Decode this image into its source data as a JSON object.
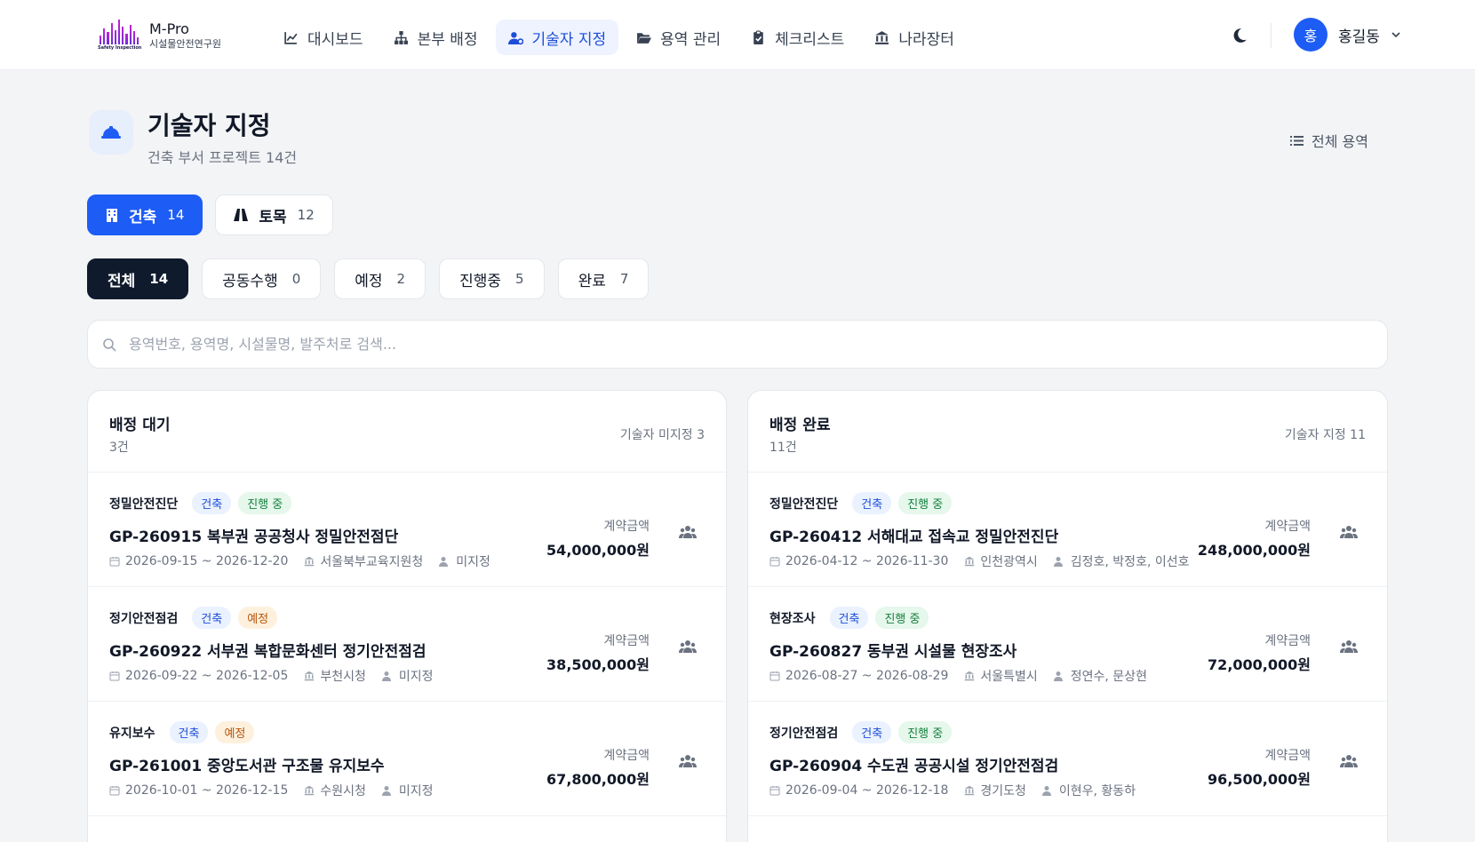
{
  "logo": {
    "title": "M-Pro",
    "subtitle": "시설물안전연구원",
    "tagline": "Safety Inspection"
  },
  "nav": [
    {
      "label": "대시보드",
      "icon": "chart-line-icon"
    },
    {
      "label": "본부 배정",
      "icon": "sitemap-icon"
    },
    {
      "label": "기술자 지정",
      "icon": "user-gear-icon",
      "active": true
    },
    {
      "label": "용역 관리",
      "icon": "folder-open-icon"
    },
    {
      "label": "체크리스트",
      "icon": "clipboard-check-icon"
    },
    {
      "label": "나라장터",
      "icon": "landmark-icon"
    }
  ],
  "user": {
    "initial": "홍",
    "name": "홍길동"
  },
  "page": {
    "title": "기술자 지정",
    "subtitle": "건축 부서 프로젝트 14건",
    "all_link": "전체 용역",
    "icon": "hard-hat-icon"
  },
  "dept_tabs": [
    {
      "label": "건축",
      "count": "14",
      "active": true,
      "icon": "building-icon"
    },
    {
      "label": "토목",
      "count": "12",
      "active": false,
      "icon": "road-icon"
    }
  ],
  "status_tabs": [
    {
      "label": "전체",
      "count": "14",
      "active": true
    },
    {
      "label": "공동수행",
      "count": "0"
    },
    {
      "label": "예정",
      "count": "2"
    },
    {
      "label": "진행중",
      "count": "5"
    },
    {
      "label": "완료",
      "count": "7"
    }
  ],
  "search": {
    "placeholder": "용역번호, 용역명, 시설물명, 발주처로 검색..."
  },
  "pending": {
    "title": "배정 대기",
    "count": "3건",
    "meta": "기술자 미지정 3",
    "items": [
      {
        "type": "정밀안전진단",
        "dept": "건축",
        "status": "진행 중",
        "status_color": "green",
        "title": "GP-260915  복부권 공공청사 정밀안전점단",
        "dates": "2026-09-15 ~ 2026-12-20",
        "client": "서울북부교육지원청",
        "engineers": "미지정",
        "amount_label": "계약금액",
        "amount": "54,000,000원"
      },
      {
        "type": "정기안전점검",
        "dept": "건축",
        "status": "예정",
        "status_color": "amber",
        "title": "GP-260922  서부권 복합문화센터 정기안전점검",
        "dates": "2026-09-22 ~ 2026-12-05",
        "client": "부천시청",
        "engineers": "미지정",
        "amount_label": "계약금액",
        "amount": "38,500,000원"
      },
      {
        "type": "유지보수",
        "dept": "건축",
        "status": "예정",
        "status_color": "amber",
        "title": "GP-261001  중앙도서관 구조물 유지보수",
        "dates": "2026-10-01 ~ 2026-12-15",
        "client": "수원시청",
        "engineers": "미지정",
        "amount_label": "계약금액",
        "amount": "67,800,000원"
      }
    ]
  },
  "assigned": {
    "title": "배정 완료",
    "count": "11건",
    "meta": "기술자 지정 11",
    "items": [
      {
        "type": "정밀안전진단",
        "dept": "건축",
        "status": "진행 중",
        "status_color": "green",
        "title": "GP-260412  서해대교 접속교 정밀안전진단",
        "dates": "2026-04-12 ~ 2026-11-30",
        "client": "인천광역시",
        "engineers": "김정호, 박정호, 이선호",
        "amount_label": "계약금액",
        "amount": "248,000,000원"
      },
      {
        "type": "현장조사",
        "dept": "건축",
        "status": "진행 중",
        "status_color": "green",
        "title": "GP-260827  동부권 시설물 현장조사",
        "dates": "2026-08-27 ~ 2026-08-29",
        "client": "서울특별시",
        "engineers": "정연수, 문상현",
        "amount_label": "계약금액",
        "amount": "72,000,000원"
      },
      {
        "type": "정기안전점검",
        "dept": "건축",
        "status": "진행 중",
        "status_color": "green",
        "title": "GP-260904  수도권 공공시설 정기안전점검",
        "dates": "2026-09-04 ~ 2026-12-18",
        "client": "경기도청",
        "engineers": "이현우, 황동하",
        "amount_label": "계약금액",
        "amount": "96,500,000원"
      }
    ]
  },
  "colors": {
    "primary": "#1d5cf5",
    "dark": "#0f1b2d",
    "nav_active_bg": "#eef3ff"
  }
}
